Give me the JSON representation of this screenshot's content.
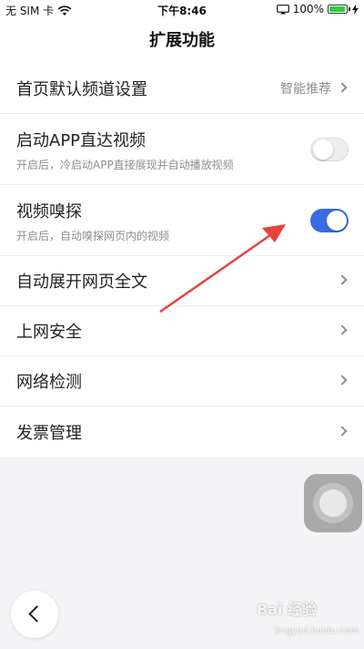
{
  "status_bar": {
    "carrier": "无 SIM 卡",
    "time": "下午8:46",
    "battery": "100%",
    "wifi_icon": "wifi-icon",
    "battery_color": "#2ecc40"
  },
  "header": {
    "title": "扩展功能"
  },
  "settings": {
    "default_channel": {
      "label": "首页默认频道设置",
      "value": "智能推荐"
    },
    "app_direct_video": {
      "label": "启动APP直达视频",
      "desc": "开启后，冷启动APP直接展现并自动播放视频",
      "enabled": false
    },
    "video_sniff": {
      "label": "视频嗅探",
      "desc": "开启后，自动嗅探网页内的视频",
      "enabled": true
    },
    "auto_expand": {
      "label": "自动展开网页全文"
    },
    "web_security": {
      "label": "上网安全"
    },
    "network_check": {
      "label": "网络检测"
    },
    "invoice": {
      "label": "发票管理"
    }
  },
  "colors": {
    "accent": "#3a6be4",
    "annotation_arrow": "#e8413c"
  },
  "watermark": {
    "brand": "Bai 经验",
    "url": "jingyan.baidu.com"
  }
}
